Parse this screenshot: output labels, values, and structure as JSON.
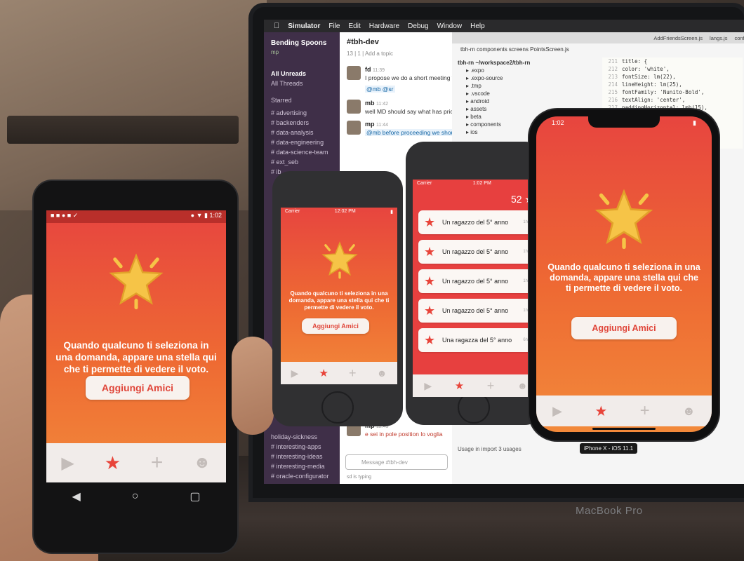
{
  "mac": {
    "menubar": [
      "Simulator",
      "File",
      "Edit",
      "Hardware",
      "Debug",
      "Window",
      "Help"
    ],
    "laptop_label": "MacBook Pro",
    "simulator_label": "iPhone X - iOS 11.1"
  },
  "slack": {
    "team": "Bending Spoons",
    "user": "mp",
    "all_unreads": "All Unreads",
    "all_threads": "All Threads",
    "starred": "Starred",
    "channels": [
      "advertising",
      "backenders",
      "data-analysis",
      "data-engineering",
      "data-science-team",
      "ext_seb",
      "ib"
    ],
    "bottom_channels": [
      "holiday-sickness",
      "interesting-apps",
      "interesting-ideas",
      "interesting-media",
      "oracle-configurator"
    ],
    "channel_title": "#tbh-dev",
    "channel_meta": "13 | 1 | Add a topic",
    "messages": [
      {
        "name": "fd",
        "time": "11:39",
        "text": "I propose we do a short meeting t"
      },
      {
        "name": "",
        "time": "",
        "text": "@mb @sr"
      },
      {
        "name": "mb",
        "time": "11:42",
        "text": "well MD should say what has prior"
      },
      {
        "name": "mp",
        "time": "11:44",
        "text": "@mb before proceeding we shoul"
      },
      {
        "name": "mp",
        "time": "12:49",
        "text": "e sei in pole position lo voglia"
      }
    ],
    "input_placeholder": "Message #tbh-dev",
    "typing": "sd is typing"
  },
  "editor": {
    "tabs": [
      "AddFriendsScreen.js",
      "langs.js",
      "config.js"
    ],
    "breadcrumb": "tbh-rn  components  screens  PointsScreen.js",
    "tree_root": "tbh-rn ~/workspace2/tbh-rn",
    "tree": [
      ".expo",
      ".expo-source",
      ".tmp",
      ".vscode",
      "android",
      "assets",
      "beta",
      "components",
      "ios"
    ],
    "code": [
      {
        "n": "211",
        "t": "title: {"
      },
      {
        "n": "212",
        "t": "  color: 'white',"
      },
      {
        "n": "213",
        "t": "  fontSize: lm(22),"
      },
      {
        "n": "214",
        "t": "  lineHeight: lm(25),"
      },
      {
        "n": "215",
        "t": "  fontFamily: 'Nunito-Bold',"
      },
      {
        "n": "216",
        "t": "  textAlign: 'center',"
      },
      {
        "n": "217",
        "t": "  paddingHorizontal: lmh(15),"
      }
    ],
    "usage": "Usage in import  3 usages"
  },
  "app": {
    "message": "Quando qualcuno ti seleziona in una domanda, appare una stella qui che ti permette di vedere il voto.",
    "button": "Aggiungi Amici",
    "points": "52",
    "list": [
      {
        "text": "Un ragazzo del 5° anno",
        "time": "1h"
      },
      {
        "text": "Un ragazzo del 5° anno",
        "time": "1h"
      },
      {
        "text": "Un ragazzo del 5° anno",
        "time": "1h"
      },
      {
        "text": "Un ragazzo del 5° anno",
        "time": "1h"
      },
      {
        "text": "Una ragazza del 5° anno",
        "time": "6h"
      }
    ]
  },
  "android": {
    "time": "1:02"
  },
  "iphone8a": {
    "carrier": "Carrier",
    "time": "12:02 PM"
  },
  "iphone8b": {
    "carrier": "Carrier",
    "time": "1:02 PM"
  },
  "iphonex": {
    "time": "1:02"
  },
  "colors": {
    "accent": "#e8443a",
    "gradient_top": "#e7453f",
    "gradient_bottom": "#f2893a",
    "slack_sidebar": "#3f2f48"
  },
  "icons": [
    "play-icon",
    "star-icon",
    "plus-icon",
    "smiley-icon",
    "back-icon",
    "home-icon",
    "recents-icon"
  ]
}
